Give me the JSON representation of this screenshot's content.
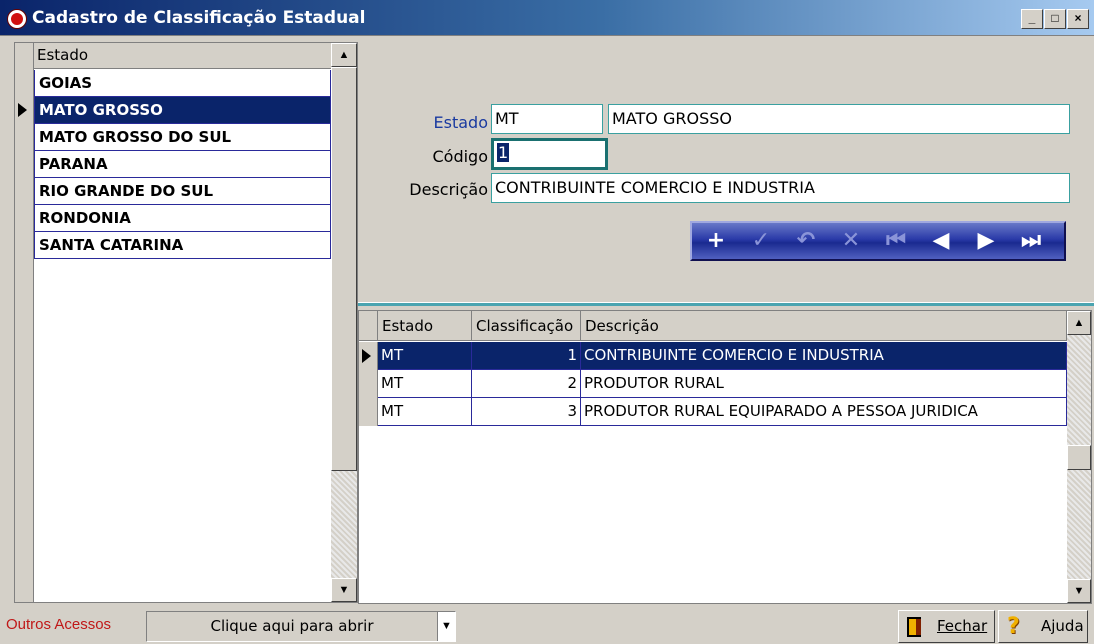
{
  "window": {
    "title": "Cadastro de Classificação Estadual",
    "minimize_glyph": "_",
    "maximize_glyph": "□",
    "close_glyph": "×"
  },
  "left_grid": {
    "header": "Estado",
    "rows": [
      "GOIAS",
      "MATO GROSSO",
      "MATO GROSSO DO SUL",
      "PARANA",
      "RIO GRANDE DO SUL",
      "RONDONIA",
      "SANTA CATARINA"
    ],
    "selected_row": "MATO GROSSO"
  },
  "form": {
    "estado_label": "Estado",
    "estado_code": "MT",
    "estado_name": "MATO GROSSO",
    "codigo_label": "Código",
    "codigo_value": "1",
    "descricao_label": "Descrição",
    "descricao_value": "CONTRIBUINTE COMERCIO E INDUSTRIA"
  },
  "navigator": {
    "buttons": [
      {
        "icon": "plus-icon",
        "glyph": "+",
        "enabled": true
      },
      {
        "icon": "check-icon",
        "glyph": "✓",
        "enabled": false
      },
      {
        "icon": "undo-icon",
        "glyph": "↶",
        "enabled": false
      },
      {
        "icon": "delete-icon",
        "glyph": "✕",
        "enabled": false
      },
      {
        "icon": "first-record-icon",
        "glyph": "⏮",
        "enabled": false
      },
      {
        "icon": "prior-record-icon",
        "glyph": "◀",
        "enabled": true
      },
      {
        "icon": "next-record-icon",
        "glyph": "▶",
        "enabled": true
      },
      {
        "icon": "last-record-icon",
        "glyph": "⏭",
        "enabled": true
      }
    ]
  },
  "detail_grid": {
    "headers": [
      "Estado",
      "Classificação",
      "Descrição"
    ],
    "rows": [
      {
        "estado": "MT",
        "classificacao": "1",
        "descricao": "CONTRIBUINTE COMERCIO E INDUSTRIA"
      },
      {
        "estado": "MT",
        "classificacao": "2",
        "descricao": "PRODUTOR RURAL"
      },
      {
        "estado": "MT",
        "classificacao": "3",
        "descricao": "PRODUTOR RURAL EQUIPARADO A PESSOA JURIDICA"
      }
    ],
    "selected_index": 0
  },
  "bottom": {
    "outros_label": "Outros Acessos",
    "combo_text": "Clique aqui para abrir",
    "fechar_label": "Fechar",
    "ajuda_label": "Ajuda"
  },
  "colors": {
    "selection": "#0a246a",
    "accent_label": "#c01818",
    "field_border": "#3aa0a0"
  }
}
